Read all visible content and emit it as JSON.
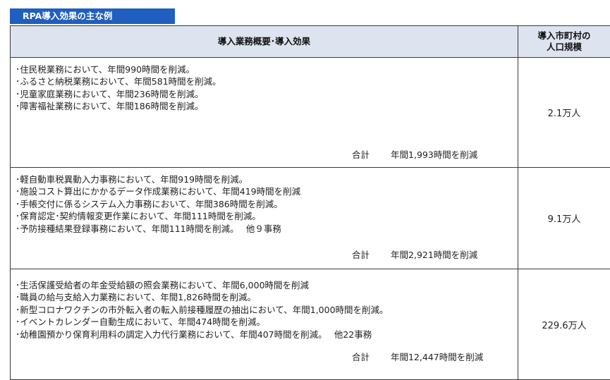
{
  "title": "RPA導入効果の主な例",
  "header": {
    "col1": "導入業務概要･導入効果",
    "col2_line1": "導入市町村の",
    "col2_line2": "人口規模"
  },
  "rows": [
    {
      "items": [
        "･住民税業務において、年間990時間を削減。",
        "･ふるさと納税業務において、年間581時間を削減。",
        "･児童家庭業務において、年間236時間を削減。",
        "･障害福祉業務において、年間186時間を削減。"
      ],
      "total_label": "合計",
      "total_value": "年間1,993時間を削減",
      "population": "2.1万人"
    },
    {
      "items": [
        "･軽自動車税異動入力事務において、年間919時間を削減。",
        "･施設コスト算出にかかるデータ作成業務において、年間419時間を削減",
        "･手帳交付に係るシステム入力事務において、年間386時間を削減。",
        "･保育認定･契約情報変更作業において、年間111時間を削減。",
        "･予防接種結果登録事務において、年間111時間を削減。　 他９事務"
      ],
      "total_label": "合計",
      "total_value": "年間2,921時間を削減",
      "population": "9.1万人"
    },
    {
      "items": [
        "･生活保護受給者の年金受給額の照会業務において、年間6,000時間を削減",
        "･職員の給与支給入力業務において、年間1,826時間を削減。",
        "･新型コロナワクチンの市外転入者の転入前接種履歴の抽出において、年間1,000時間を削減。",
        "･イベントカレンダー自動生成において、年間474時間を削減。",
        "･幼稚園預かり保育利用料の調定入力代行業務において、年間407時間を削減。　 他22事務"
      ],
      "total_label": "合計",
      "total_value": "年間12,447時間を削減",
      "population": "229.6万人"
    }
  ],
  "colors": {
    "title_bg": "#1f5fbf",
    "header_bg": "#dde4ef",
    "border": "#3a3a3a"
  }
}
